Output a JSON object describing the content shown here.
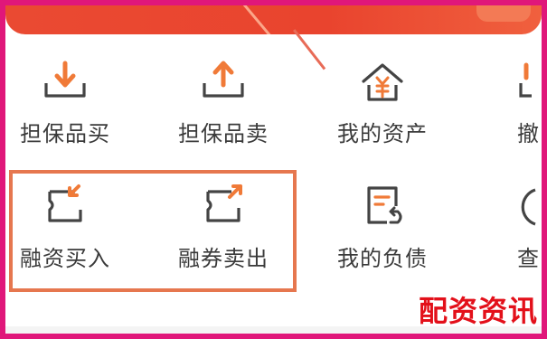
{
  "menu": {
    "row1": [
      {
        "label": "担保品买",
        "icon": "tray-download-icon"
      },
      {
        "label": "担保品卖",
        "icon": "tray-upload-icon"
      },
      {
        "label": "我的资产",
        "icon": "house-yen-icon"
      },
      {
        "label": "撤",
        "icon": "partial-icon"
      }
    ],
    "row2": [
      {
        "label": "融资买入",
        "icon": "ticket-arrow-in-icon"
      },
      {
        "label": "融券卖出",
        "icon": "ticket-arrow-out-icon"
      },
      {
        "label": "我的负债",
        "icon": "document-return-icon"
      },
      {
        "label": "查",
        "icon": "partial-circle-icon"
      }
    ]
  },
  "watermark": "配资资讯",
  "colors": {
    "accent": "#f07a38",
    "banner": "#e9442e",
    "frame": "#e0177a",
    "watermark": "#e3101a",
    "text": "#3a3a3a",
    "icon_stroke": "#444444"
  }
}
